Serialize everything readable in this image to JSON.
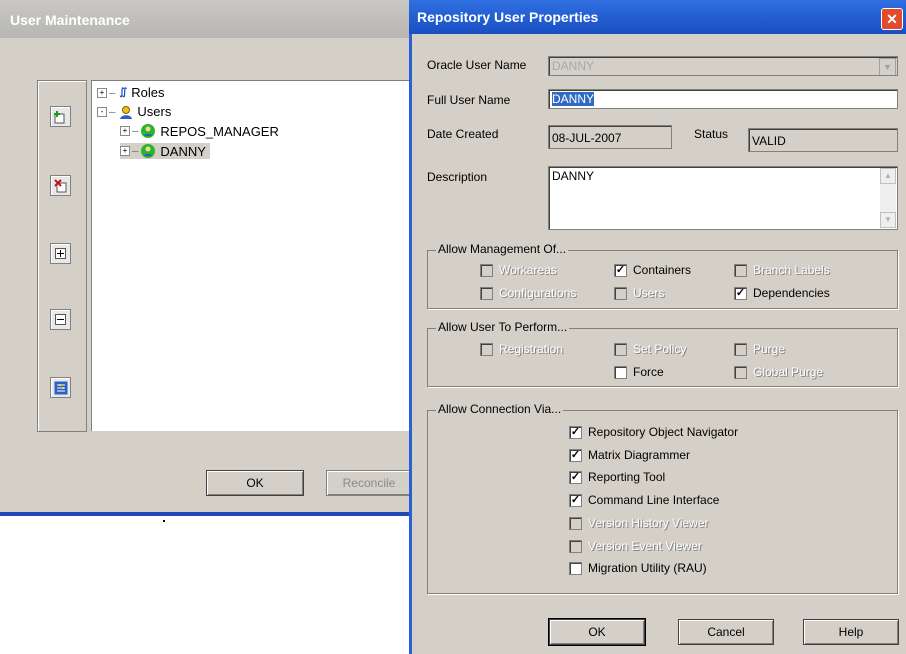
{
  "background_window": {
    "title": "User Maintenance",
    "tree": {
      "roles": "Roles",
      "users": "Users",
      "user_items": [
        "REPOS_MANAGER",
        "DANNY"
      ]
    },
    "ok_label": "OK",
    "reconcile_label": "Reconcile"
  },
  "dialog": {
    "title": "Repository User Properties",
    "close_icon": "close-icon",
    "fields": {
      "oracle_user_name_label": "Oracle User Name",
      "oracle_user_name_value": "DANNY",
      "full_user_name_label": "Full User Name",
      "full_user_name_value": "DANNY",
      "date_created_label": "Date Created",
      "date_created_value": "08-JUL-2007",
      "status_label": "Status",
      "status_value": "VALID",
      "description_label": "Description",
      "description_value": "DANNY"
    },
    "allow_management": {
      "title": "Allow Management Of...",
      "items": [
        {
          "label": "Workareas",
          "checked": false,
          "enabled": false
        },
        {
          "label": "Containers",
          "checked": true,
          "enabled": true
        },
        {
          "label": "Branch Labels",
          "checked": false,
          "enabled": false
        },
        {
          "label": "Configurations",
          "checked": false,
          "enabled": false
        },
        {
          "label": "Users",
          "checked": false,
          "enabled": false
        },
        {
          "label": "Dependencies",
          "checked": true,
          "enabled": true
        }
      ]
    },
    "allow_perform": {
      "title": "Allow User To Perform...",
      "items": [
        {
          "label": "Registration",
          "checked": false,
          "enabled": false
        },
        {
          "label": "Set Policy",
          "checked": false,
          "enabled": false
        },
        {
          "label": "Purge",
          "checked": false,
          "enabled": false
        },
        {
          "label": "Force",
          "checked": false,
          "enabled": true
        },
        {
          "label": "Global Purge",
          "checked": false,
          "enabled": false
        }
      ]
    },
    "allow_connection": {
      "title": "Allow Connection Via...",
      "items": [
        {
          "label": "Repository Object Navigator",
          "checked": true,
          "enabled": true
        },
        {
          "label": "Matrix Diagrammer",
          "checked": true,
          "enabled": true
        },
        {
          "label": "Reporting Tool",
          "checked": true,
          "enabled": true
        },
        {
          "label": "Command Line Interface",
          "checked": true,
          "enabled": true
        },
        {
          "label": "Version History Viewer",
          "checked": false,
          "enabled": false
        },
        {
          "label": "Version Event Viewer",
          "checked": false,
          "enabled": false
        },
        {
          "label": "Migration Utility (RAU)",
          "checked": false,
          "enabled": true
        }
      ]
    },
    "buttons": {
      "ok": "OK",
      "cancel": "Cancel",
      "help": "Help"
    }
  },
  "colors": {
    "dialog_title": "#1a4fc4",
    "window_face": "#d4d0c8",
    "selection": "#316ac5"
  }
}
